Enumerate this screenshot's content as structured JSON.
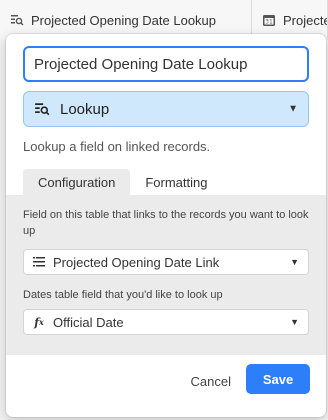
{
  "header": {
    "column_1": {
      "label": "Projected Opening Date Lookup",
      "icon": "lookup-icon"
    },
    "column_2": {
      "label": "Projecte",
      "icon": "calendar-icon"
    }
  },
  "dialog": {
    "field_name": "Projected Opening Date Lookup",
    "field_type": {
      "label": "Lookup",
      "icon": "lookup-icon"
    },
    "description": "Lookup a field on linked records.",
    "tabs": [
      {
        "label": "Configuration",
        "active": true
      },
      {
        "label": "Formatting",
        "active": false
      }
    ],
    "link_field_label": "Field on this table that links to the records you want to look up",
    "link_field_value": "Projected Opening Date Link",
    "lookup_table_name": "Dates",
    "lookup_field_label_suffix": " table field that you'd like to look up",
    "lookup_field_value": "Official Date",
    "lookup_field_icon": "formula-icon",
    "cancel_label": "Cancel",
    "save_label": "Save"
  },
  "colors": {
    "accent": "#2d7ff9",
    "type_bg": "#d0e8fc",
    "panel_bg": "#ebebeb"
  }
}
